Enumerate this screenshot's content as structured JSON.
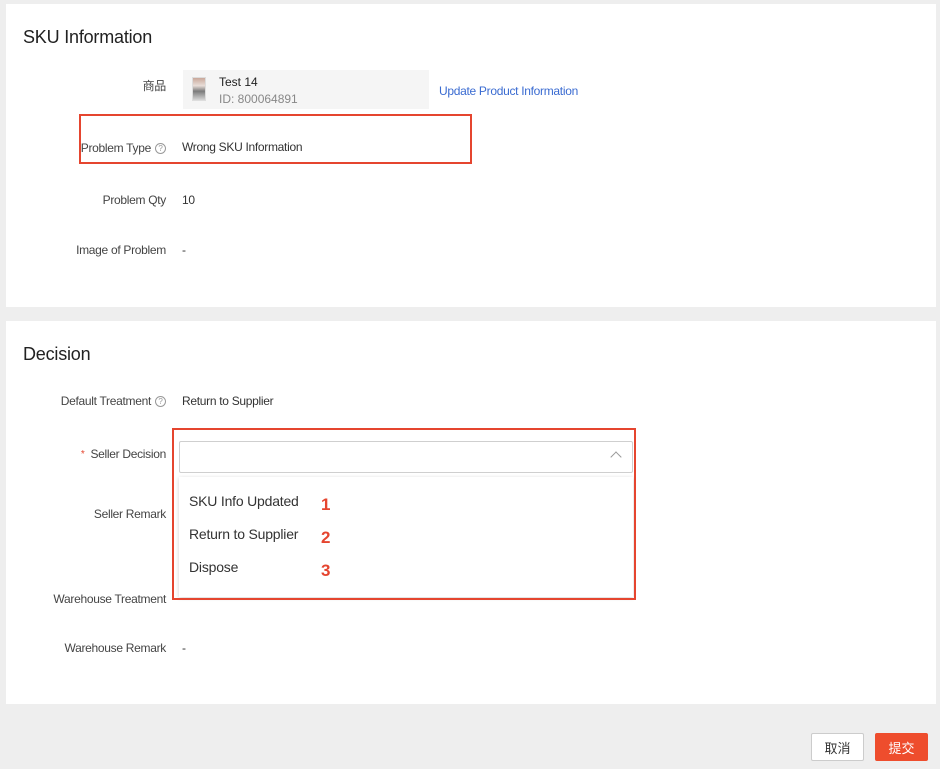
{
  "sku_section": {
    "title": "SKU Information",
    "product_label": "商品",
    "product_name": "Test 14",
    "product_id": "ID: 800064891",
    "update_link": "Update Product Information",
    "problem_type_label": "Problem Type",
    "problem_type_value": "Wrong SKU Information",
    "problem_qty_label": "Problem Qty",
    "problem_qty_value": "10",
    "image_label": "Image of Problem",
    "image_value": "-"
  },
  "decision_section": {
    "title": "Decision",
    "default_treatment_label": "Default Treatment",
    "default_treatment_value": "Return to Supplier",
    "required_mark": "*",
    "seller_decision_label": "Seller Decision",
    "seller_decision_value": "",
    "seller_remark_label": "Seller Remark",
    "warehouse_treatment_label": "Warehouse Treatment",
    "warehouse_remark_label": "Warehouse Remark",
    "warehouse_remark_value": "-",
    "options": [
      {
        "label": "SKU Info Updated",
        "number": "1"
      },
      {
        "label": "Return to Supplier",
        "number": "2"
      },
      {
        "label": "Dispose",
        "number": "3"
      }
    ]
  },
  "footer": {
    "cancel_label": "取消",
    "submit_label": "提交"
  },
  "colors": {
    "accent": "#ee4d2d",
    "annotation": "#e5452f",
    "link": "#3a6bd1"
  }
}
